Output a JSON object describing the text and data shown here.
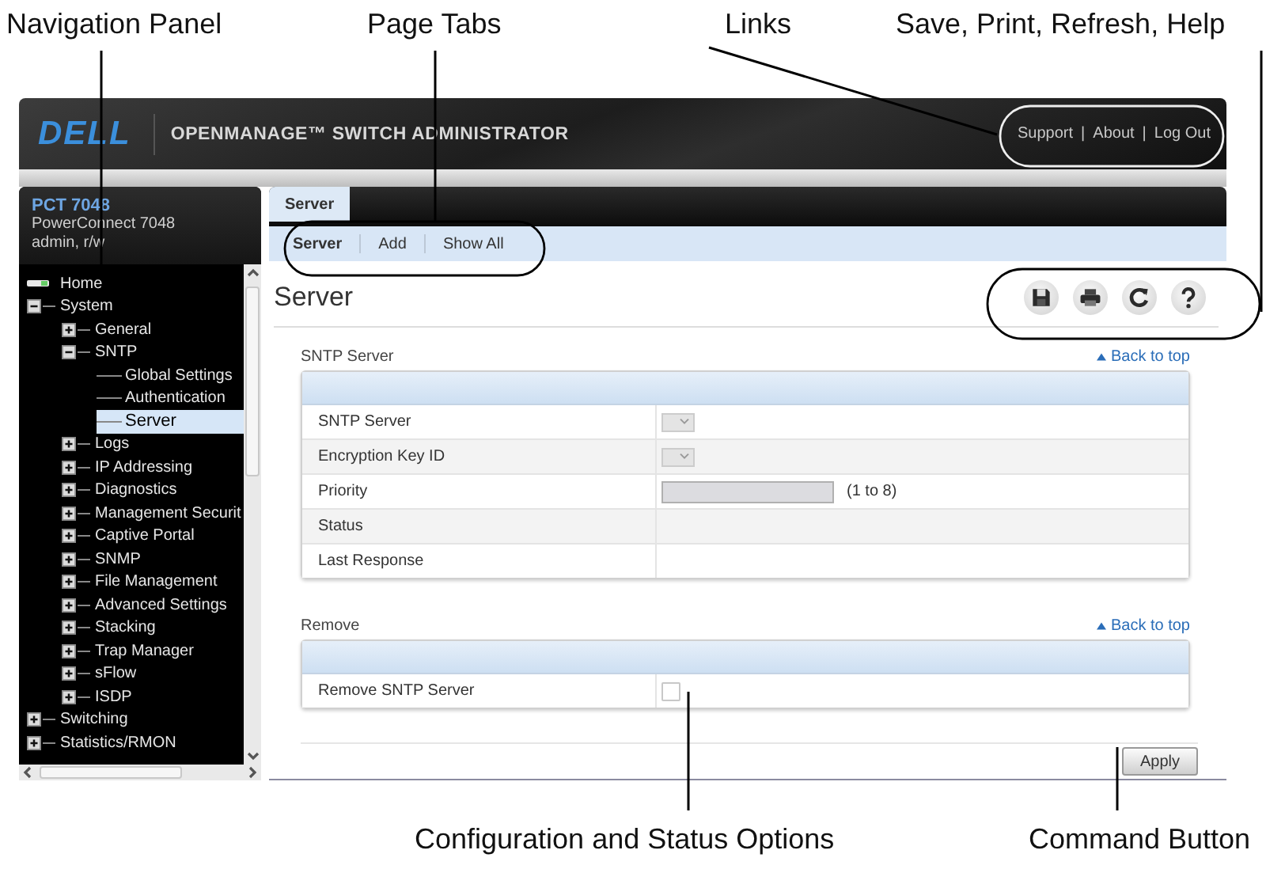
{
  "callouts": {
    "top": [
      "Navigation Panel",
      "Page Tabs",
      "Links",
      "Save, Print, Refresh, Help"
    ],
    "bottom": [
      "Configuration and Status Options",
      "Command Button"
    ]
  },
  "header": {
    "logo": "DELL",
    "title": "OPENMANAGE™ SWITCH ADMINISTRATOR",
    "links": [
      "Support",
      "About",
      "Log Out"
    ],
    "separator": "|"
  },
  "nav": {
    "device": "PCT 7048",
    "model": "PowerConnect 7048",
    "user": "admin, r/w",
    "tree": [
      {
        "label": "Home",
        "kind": "home",
        "selected": false
      },
      {
        "label": "System",
        "kind": "folder",
        "expanded": true,
        "selected": false,
        "children": [
          {
            "label": "General",
            "kind": "folder",
            "expanded": false,
            "selected": false
          },
          {
            "label": "SNTP",
            "kind": "folder",
            "expanded": true,
            "selected": false,
            "children": [
              {
                "label": "Global Settings",
                "kind": "page",
                "selected": false
              },
              {
                "label": "Authentication",
                "kind": "page",
                "selected": false
              },
              {
                "label": "Server",
                "kind": "page",
                "selected": true
              }
            ]
          },
          {
            "label": "Logs",
            "kind": "folder",
            "expanded": false,
            "selected": false
          },
          {
            "label": "IP Addressing",
            "kind": "folder",
            "expanded": false,
            "selected": false
          },
          {
            "label": "Diagnostics",
            "kind": "folder",
            "expanded": false,
            "selected": false
          },
          {
            "label": "Management Securit",
            "kind": "folder",
            "expanded": false,
            "selected": false
          },
          {
            "label": "Captive Portal",
            "kind": "folder",
            "expanded": false,
            "selected": false
          },
          {
            "label": "SNMP",
            "kind": "folder",
            "expanded": false,
            "selected": false
          },
          {
            "label": "File Management",
            "kind": "folder",
            "expanded": false,
            "selected": false
          },
          {
            "label": "Advanced Settings",
            "kind": "folder",
            "expanded": false,
            "selected": false
          },
          {
            "label": "Stacking",
            "kind": "folder",
            "expanded": false,
            "selected": false
          },
          {
            "label": "Trap Manager",
            "kind": "folder",
            "expanded": false,
            "selected": false
          },
          {
            "label": "sFlow",
            "kind": "folder",
            "expanded": false,
            "selected": false
          },
          {
            "label": "ISDP",
            "kind": "folder",
            "expanded": false,
            "selected": false
          }
        ]
      },
      {
        "label": "Switching",
        "kind": "folder",
        "expanded": false,
        "selected": false
      },
      {
        "label": "Statistics/RMON",
        "kind": "folder",
        "expanded": false,
        "selected": false
      }
    ]
  },
  "page": {
    "tabs": [
      {
        "label": "Server",
        "selected": true
      }
    ],
    "subtabs": [
      {
        "label": "Server",
        "selected": true
      },
      {
        "label": "Add",
        "selected": false
      },
      {
        "label": "Show All",
        "selected": false
      }
    ],
    "title": "Server",
    "tools": [
      {
        "kind": "save"
      },
      {
        "kind": "print"
      },
      {
        "kind": "refresh"
      },
      {
        "kind": "help"
      }
    ],
    "sections": [
      {
        "title": "SNTP Server",
        "back_link": "Back to top",
        "rows": [
          {
            "label": "SNTP Server",
            "kind": "select",
            "disabled": true
          },
          {
            "label": "Encryption Key ID",
            "kind": "select",
            "disabled": true
          },
          {
            "label": "Priority",
            "kind": "input",
            "disabled": true,
            "hint": "(1 to 8)"
          },
          {
            "label": "Status",
            "kind": "text"
          },
          {
            "label": "Last Response",
            "kind": "text"
          }
        ]
      },
      {
        "title": "Remove",
        "back_link": "Back to top",
        "rows": [
          {
            "label": "Remove SNTP Server",
            "kind": "checkbox",
            "checked": false
          }
        ]
      }
    ],
    "apply_button": "Apply"
  }
}
